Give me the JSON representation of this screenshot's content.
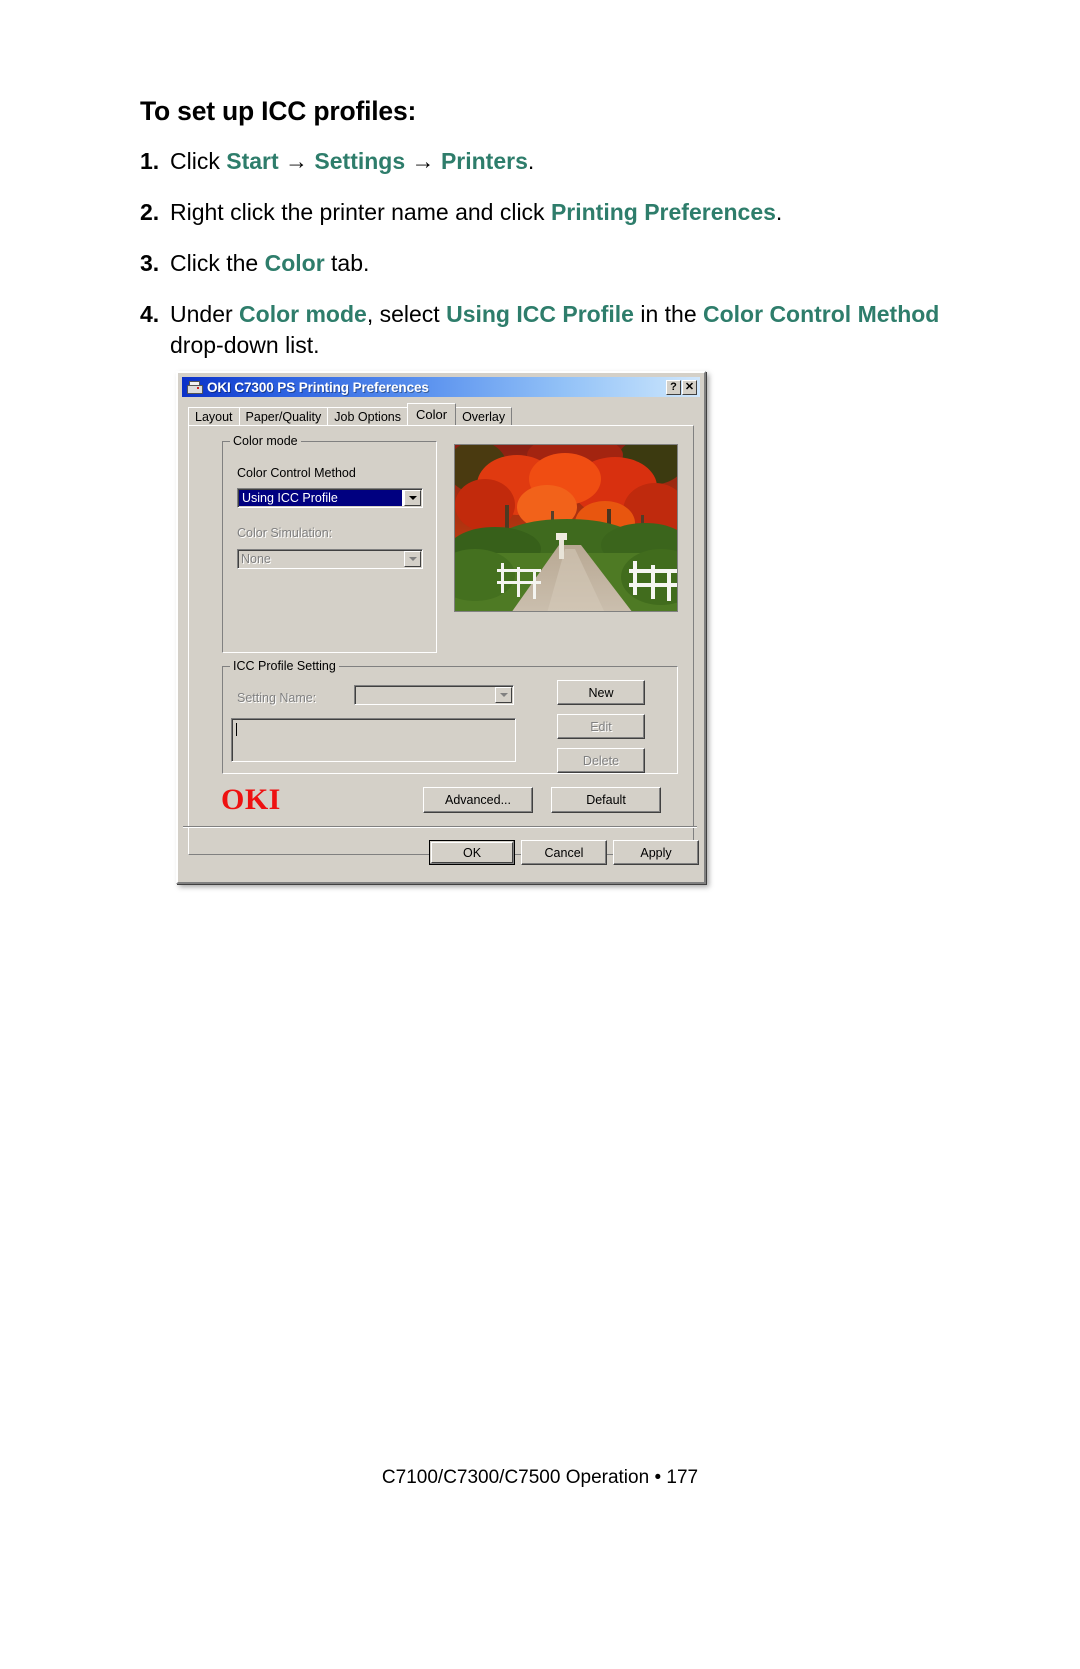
{
  "document": {
    "heading": "To set up ICC profiles:",
    "steps": [
      {
        "num": "1.",
        "parts": [
          {
            "t": "Click ",
            "kw": false
          },
          {
            "t": "Start",
            "kw": true
          },
          {
            "t": " → ",
            "kw": false
          },
          {
            "t": "Settings",
            "kw": true
          },
          {
            "t": " → ",
            "kw": false
          },
          {
            "t": "Printers",
            "kw": true
          },
          {
            "t": ".",
            "kw": false
          }
        ]
      },
      {
        "num": "2.",
        "parts": [
          {
            "t": "Right click the printer name and click ",
            "kw": false
          },
          {
            "t": "Printing Preferences",
            "kw": true
          },
          {
            "t": ".",
            "kw": false
          }
        ]
      },
      {
        "num": "3.",
        "parts": [
          {
            "t": "Click the ",
            "kw": false
          },
          {
            "t": "Color",
            "kw": true
          },
          {
            "t": " tab.",
            "kw": false
          }
        ]
      },
      {
        "num": "4.",
        "parts": [
          {
            "t": "Under ",
            "kw": false
          },
          {
            "t": "Color mode",
            "kw": true
          },
          {
            "t": ", select ",
            "kw": false
          },
          {
            "t": "Using ICC Profile",
            "kw": true
          },
          {
            "t": " in the ",
            "kw": false
          },
          {
            "t": "Color Control Method",
            "kw": true
          },
          {
            "t": " drop-down list.",
            "kw": false
          }
        ]
      }
    ],
    "footer": "C7100/C7300/C7500  Operation • 177",
    "keyword_color": "#2e7d6b"
  },
  "dialog": {
    "title": "OKI C7300 PS Printing Preferences",
    "title_icon": "printer-icon",
    "titlebar_buttons": [
      {
        "name": "help-button",
        "label": "?"
      },
      {
        "name": "close-button",
        "label": "✕"
      }
    ],
    "tabs": [
      {
        "label": "Layout",
        "active": false
      },
      {
        "label": "Paper/Quality",
        "active": false
      },
      {
        "label": "Job Options",
        "active": false
      },
      {
        "label": "Color",
        "active": true
      },
      {
        "label": "Overlay",
        "active": false
      }
    ],
    "color_mode": {
      "group_label": "Color mode",
      "control_method_label": "Color Control Method",
      "control_method_value": "Using ICC Profile",
      "control_method_selected": true,
      "simulation_label": "Color Simulation:",
      "simulation_value": "None",
      "simulation_disabled": true
    },
    "icc_profile_setting": {
      "group_label": "ICC Profile Setting",
      "setting_name_label": "Setting Name:",
      "setting_name_value": "",
      "setting_name_disabled": true,
      "list_value": "",
      "buttons": [
        {
          "label": "New",
          "disabled": false
        },
        {
          "label": "Edit",
          "disabled": true
        },
        {
          "label": "Delete",
          "disabled": true
        }
      ]
    },
    "brand_logo": "OKI",
    "action_buttons": [
      {
        "label": "Advanced...",
        "disabled": false
      },
      {
        "label": "Default",
        "disabled": false
      }
    ],
    "footer_buttons": [
      {
        "label": "OK",
        "default": true
      },
      {
        "label": "Cancel",
        "default": false
      },
      {
        "label": "Apply",
        "default": false
      }
    ],
    "preview_alt": "autumn-trees-road-preview"
  }
}
